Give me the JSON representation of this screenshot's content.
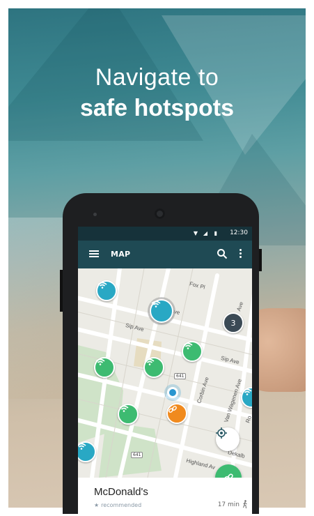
{
  "promo": {
    "headline_line1": "Navigate to",
    "headline_line2": "safe hotspots"
  },
  "phone": {
    "status_bar": {
      "time": "12:30"
    },
    "app_bar": {
      "title": "MAP",
      "icons": [
        "menu-icon",
        "search-icon",
        "more-vert-icon"
      ]
    },
    "map": {
      "streets": [
        "Fox Pl",
        "Sip Ave",
        "Sip Ave",
        "...n Ave",
        "Ave",
        "Corbin Ave",
        "Van Wagenen Ave",
        "Highland Av",
        "Dekalb",
        "Ro"
      ],
      "route_shields": [
        "641",
        "641"
      ],
      "cluster_count": "3"
    },
    "place_card": {
      "name": "McDonald's",
      "tag": "recommended",
      "eta": "17 min"
    }
  },
  "colors": {
    "app_bar": "#1f4a54",
    "status_bar": "#16323a",
    "wifi_teal": "#29a8c4",
    "wifi_green": "#3dbb71",
    "link_orange": "#f08a1e",
    "cluster": "#3b4a55"
  }
}
